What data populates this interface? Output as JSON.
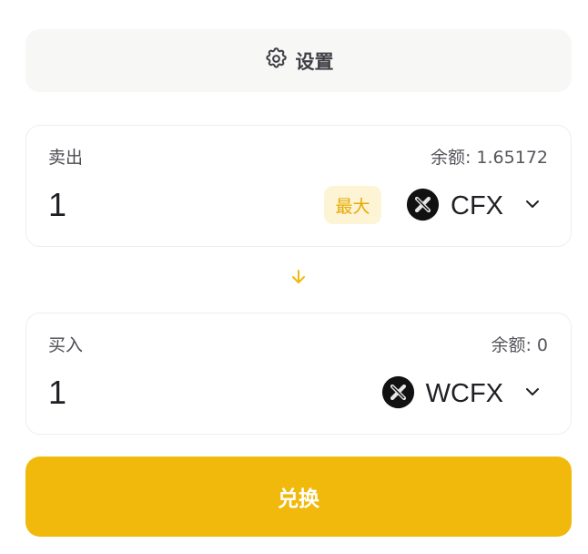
{
  "settings": {
    "label": "设置",
    "icon": "gear-icon"
  },
  "sell": {
    "title": "卖出",
    "balance_text": "余额: 1.65172",
    "amount": "1",
    "max_label": "最大",
    "token": {
      "symbol": "CFX",
      "icon": "cfx-token-logo"
    }
  },
  "swap_direction_icon": "arrow-down-icon",
  "buy": {
    "title": "买入",
    "balance_text": "余额: 0",
    "amount": "1",
    "token": {
      "symbol": "WCFX",
      "icon": "cfx-token-logo"
    }
  },
  "action": {
    "label": "兑换"
  },
  "colors": {
    "accent": "#f0b90b",
    "max_text": "#e6ab00",
    "max_bg": "#fdf3d5"
  }
}
